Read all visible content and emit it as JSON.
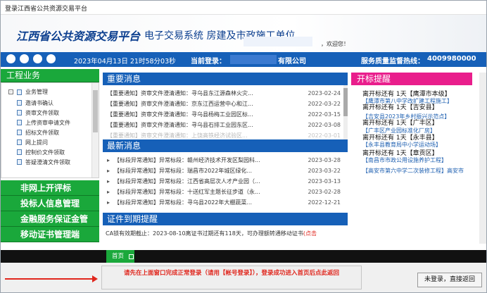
{
  "window_title": "登录江西省公共资源交易平台",
  "banner": {
    "brand": "江西省公共资源交易平台",
    "system": "电子交易系统 房建及市政施工单位",
    "welcome": "，欢迎您！"
  },
  "navbar": {
    "icons": [
      "home-icon",
      "gear-icon",
      "users-icon",
      "support-icon"
    ],
    "datetime": "2023年04月13日 21时58分03秒",
    "current_login_label": "当前登录：",
    "current_user_suffix": "有限公司",
    "hotline_label": "服务质量监督热线：",
    "hotline": "4009980000"
  },
  "sidebar": {
    "header": "工程业务",
    "root": "业务管理",
    "items": [
      "邀请书确认",
      "资审文件领取",
      "上传资审申请文件",
      "招标文件领取",
      "网上提问",
      "控制价文件领取",
      "答疑澄清文件领取"
    ],
    "groups": [
      "非网上开评标",
      "投标人信息管理",
      "金融服务保证金管",
      "移动证书管理端"
    ]
  },
  "important": {
    "title": "重要消息",
    "rows": [
      {
        "text": "【重要通知】资审文件澄清通知：寻乌县东江源森林火灾...",
        "date": "2023-02-24"
      },
      {
        "text": "【重要通知】资审文件澄清通知：京东江西运营中心和江...",
        "date": "2022-03-22"
      },
      {
        "text": "【重要通知】资审文件澄清通知：寻乌县杨梅工业园区标...",
        "date": "2022-03-15"
      },
      {
        "text": "【重要通知】资审文件澄清通知：寻乌县石排工业园东区...",
        "date": "2022-03-08"
      },
      {
        "text": "【重要通知】资审文件澄清通知：上饶高铁经济试验区...",
        "date": "2022-03-01"
      }
    ]
  },
  "latest": {
    "title": "最新消息",
    "rows": [
      {
        "text": "【标段异常通知】异常标段：赣州经济技术开发区梨园科...",
        "date": "2023-03-28"
      },
      {
        "text": "【标段异常通知】异常标段：瑞昌市2022年城区绿化...",
        "date": "2023-03-22"
      },
      {
        "text": "【标段异常通知】异常标段：江西省高层次人才产业园（...",
        "date": "2023-03-13"
      },
      {
        "text": "【标段异常通知】异常标段：十送红军主题长征步道（永...",
        "date": "2023-02-28"
      },
      {
        "text": "【标段异常通知】异常标段：寻乌县2022年大棚蔬菜...",
        "date": "2022-12-21"
      }
    ]
  },
  "cert": {
    "title": "证件到期提醒",
    "text": "CA锁有效期截止：2023-08-10离证书过期还有118天，可办理额转通移动证书",
    "link": "(点击"
  },
  "reminder": {
    "title": "开标提醒",
    "dark_lines": [
      "离开标还有 1天【鹰潭市本级】",
      "离开标还有 1天【吉安县】",
      "离开标还有 1天【广丰区】",
      "离开标还有 1天【永丰县】",
      "离开标还有 1天【章贡区】"
    ],
    "blue_lines": [
      "【鹰潭市第八中学改扩建工程施工】",
      "【吉安县2023年乡村振兴示范点】",
      "【广丰区产业园标准化厂房】",
      "【永丰县教育局中小学运动场】",
      "【南昌市市政公用设施养护工程】",
      "【高安市第六中学二次装修工程】高安市"
    ]
  },
  "tab": {
    "label": "首页"
  },
  "footer": {
    "notice": "请先在上面窗口完成正常登录（请用【帐号登录】），登录成功进入首页后点此返回",
    "exit_button": "未登录，直接返回"
  }
}
